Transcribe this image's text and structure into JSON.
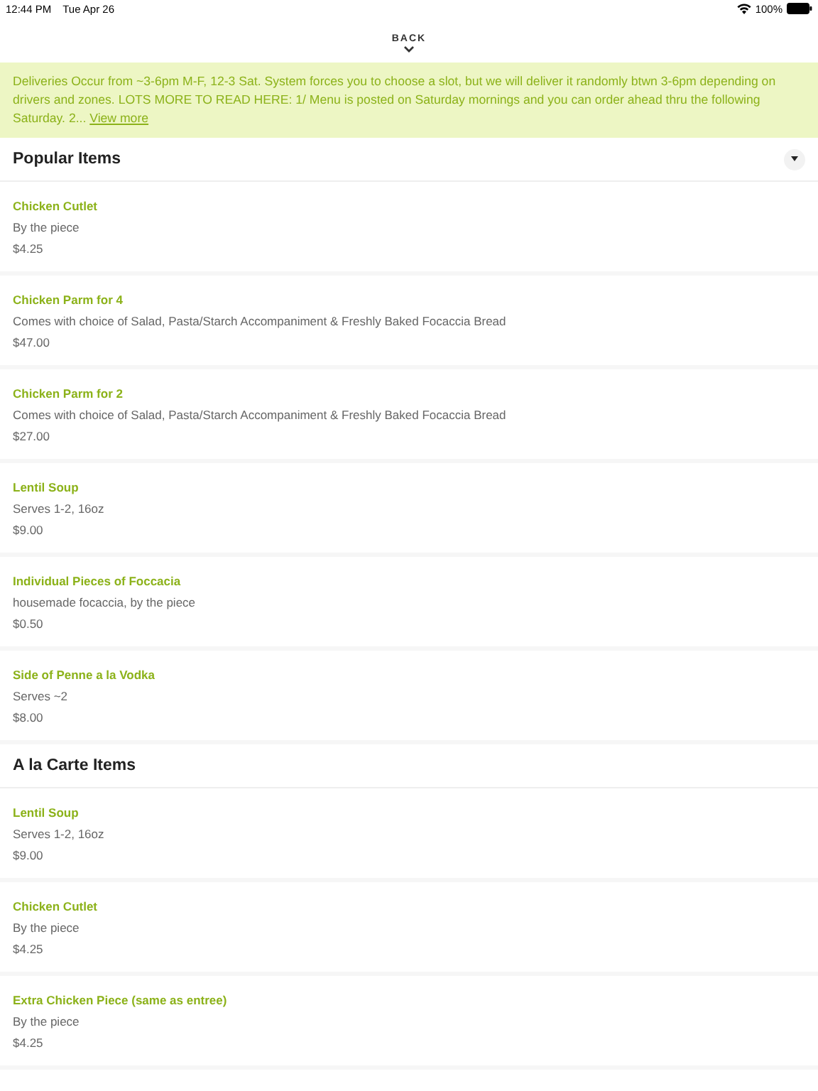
{
  "status_bar": {
    "time": "12:44 PM",
    "date": "Tue Apr 26",
    "battery": "100%"
  },
  "back": {
    "label": "BACK"
  },
  "notice": {
    "text": "Deliveries Occur from ~3-6pm M-F, 12-3 Sat. System forces you to choose a slot, but we will deliver it randomly btwn 3-6pm depending on drivers and zones. LOTS MORE TO READ HERE: 1/ Menu is posted on Saturday mornings and you can order ahead thru the following Saturday. 2...",
    "link": "View more"
  },
  "sections": [
    {
      "title": "Popular Items",
      "collapsible": true,
      "items": [
        {
          "name": "Chicken Cutlet",
          "description": "By the piece",
          "price": "$4.25"
        },
        {
          "name": "Chicken Parm for 4",
          "description": "Comes with choice of Salad, Pasta/Starch Accompaniment & Freshly Baked Focaccia Bread",
          "price": "$47.00"
        },
        {
          "name": "Chicken Parm for 2",
          "description": "Comes with choice of Salad, Pasta/Starch Accompaniment & Freshly Baked Focaccia Bread",
          "price": "$27.00"
        },
        {
          "name": "Lentil Soup",
          "description": "Serves 1-2, 16oz",
          "price": "$9.00"
        },
        {
          "name": "Individual Pieces of Foccacia",
          "description": "housemade focaccia, by the piece",
          "price": "$0.50"
        },
        {
          "name": "Side of Penne a la Vodka",
          "description": "Serves ~2",
          "price": "$8.00"
        }
      ]
    },
    {
      "title": "A la Carte Items",
      "collapsible": false,
      "items": [
        {
          "name": "Lentil Soup",
          "description": "Serves 1-2, 16oz",
          "price": "$9.00"
        },
        {
          "name": "Chicken Cutlet",
          "description": "By the piece",
          "price": "$4.25"
        },
        {
          "name": "Extra Chicken Piece (same as entree)",
          "description": "By the piece",
          "price": "$4.25"
        }
      ]
    }
  ]
}
